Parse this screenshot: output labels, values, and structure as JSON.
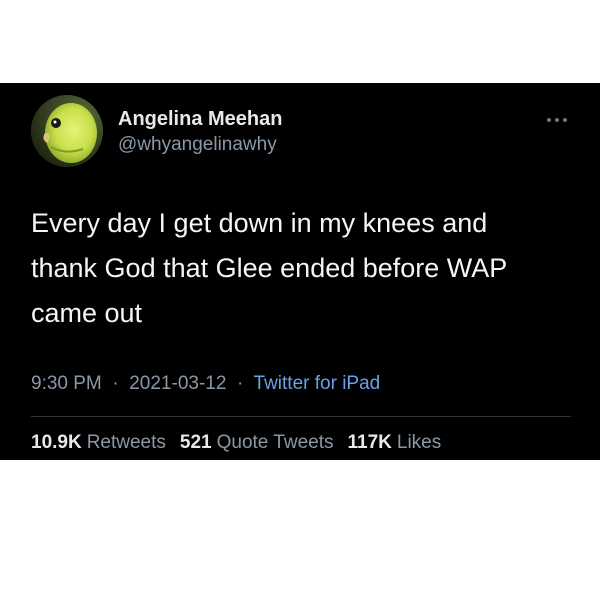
{
  "tweet": {
    "author": {
      "name": "Angelina Meehan",
      "handle": "@whyangelinawhy"
    },
    "text_lines": [
      "Every day I get down in my knees and",
      "thank God that Glee ended before WAP",
      "came out"
    ],
    "time": "9:30 PM",
    "date": "2021-03-12",
    "separator": "·",
    "source": "Twitter for iPad",
    "stats": {
      "retweets": {
        "value": "10.9K",
        "label": "Retweets"
      },
      "quote_tweets": {
        "value": "521",
        "label": "Quote Tweets"
      },
      "likes": {
        "value": "117K",
        "label": "Likes"
      }
    },
    "more_icon": "ellipsis-icon",
    "avatar_icon": "parakeet-avatar"
  },
  "colors": {
    "background": "#000000",
    "primary_text": "#e7e9ea",
    "secondary_text": "#8b98a5",
    "link": "#6ba1e8",
    "divider": "#2f3336"
  }
}
